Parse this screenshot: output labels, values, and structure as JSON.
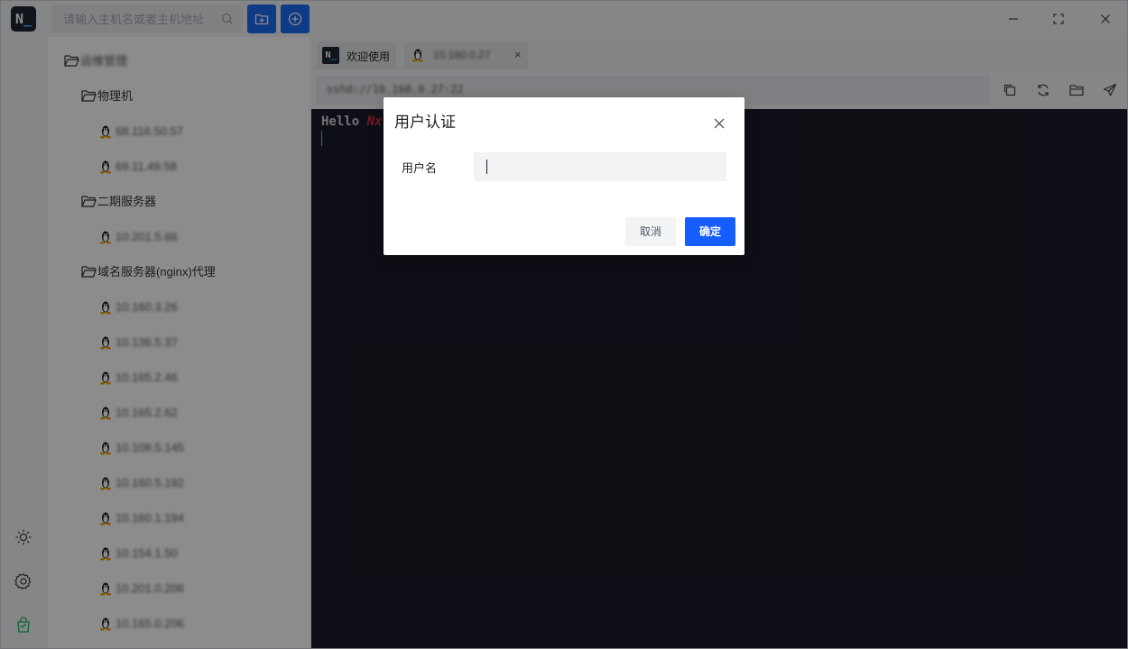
{
  "app": {
    "logo_text": "N",
    "logo_underscore": "_",
    "search_placeholder": "请输入主机名或者主机地址"
  },
  "tree": {
    "root": "运维管理",
    "items": [
      {
        "type": "folder",
        "label": "物理机",
        "blur": false,
        "indent": 1
      },
      {
        "type": "host",
        "label": "68.116.50.57",
        "blur": true,
        "indent": 2
      },
      {
        "type": "host",
        "label": "69.11.49.58",
        "blur": true,
        "indent": 2
      },
      {
        "type": "folder",
        "label": "二期服务器",
        "blur": false,
        "indent": 1
      },
      {
        "type": "host",
        "label": "10.201.5.66",
        "blur": true,
        "indent": 2
      },
      {
        "type": "folder",
        "label": "域名服务器(nginx)代理",
        "blur": false,
        "indent": 1
      },
      {
        "type": "host",
        "label": "10.160.3.26",
        "blur": true,
        "indent": 2
      },
      {
        "type": "host",
        "label": "10.136.5.37",
        "blur": true,
        "indent": 2
      },
      {
        "type": "host",
        "label": "10.165.2.46",
        "blur": true,
        "indent": 2
      },
      {
        "type": "host",
        "label": "10.165.2.62",
        "blur": true,
        "indent": 2
      },
      {
        "type": "host",
        "label": "10.108.5.145",
        "blur": true,
        "indent": 2
      },
      {
        "type": "host",
        "label": "10.160.5.192",
        "blur": true,
        "indent": 2
      },
      {
        "type": "host",
        "label": "10.160.1.194",
        "blur": true,
        "indent": 2
      },
      {
        "type": "host",
        "label": "10.154.1.50",
        "blur": true,
        "indent": 2
      },
      {
        "type": "host",
        "label": "10.201.0.206",
        "blur": true,
        "indent": 2
      },
      {
        "type": "host",
        "label": "10.165.0.206",
        "blur": true,
        "indent": 2
      }
    ]
  },
  "tabs": [
    {
      "label": "欢迎使用",
      "icon": "nx-logo-icon"
    },
    {
      "label": "10.160.0.27",
      "icon": "linux-icon",
      "closable": true,
      "close_glyph": "×"
    }
  ],
  "toolbar": {
    "path": "sshd://10.160.0.27:22",
    "icons": [
      "copy-icon",
      "refresh-icon",
      "folder-icon",
      "send-icon"
    ]
  },
  "terminal": {
    "hello": "Hello",
    "brand": "Nx"
  },
  "dialog": {
    "title": "用户认证",
    "username_label": "用户名",
    "username_value": "",
    "cancel_label": "取消",
    "ok_label": "确定"
  },
  "colors": {
    "accent": "#165dff",
    "terminal_bg": "#1b1d28",
    "brand_red": "#d3313b"
  }
}
